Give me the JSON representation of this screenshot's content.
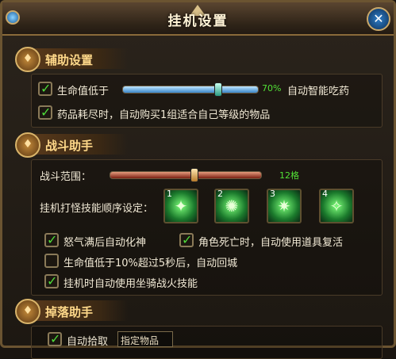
{
  "window": {
    "title": "挂机设置",
    "close_label": "✕"
  },
  "sections": {
    "assist": {
      "title": "辅助设置",
      "hp_label": "生命值低于",
      "hp_percent": "70%",
      "hp_value": 0.7,
      "auto_drink_label": "自动智能吃药",
      "hp_checked": true,
      "auto_buy_label": "药品耗尽时，自动购买1组适合自己等级的物品",
      "auto_buy_checked": true
    },
    "battle": {
      "title": "战斗助手",
      "range_label": "战斗范围：",
      "range_value_text": "12格",
      "range_fraction": 0.55,
      "skill_order_label": "挂机打怪技能顺序设定：",
      "skills": [
        {
          "num": "1",
          "icon": "green-blade-skill-icon"
        },
        {
          "num": "2",
          "icon": "green-burst-skill-icon"
        },
        {
          "num": "3",
          "icon": "green-beast-skill-icon"
        },
        {
          "num": "4",
          "icon": "green-strike-skill-icon"
        }
      ],
      "options": [
        {
          "label": "怒气满后自动化神",
          "checked": true
        },
        {
          "label": "角色死亡时，自动使用道具复活",
          "checked": true
        },
        {
          "label": "生命值低于10%超过5秒后，自动回城",
          "checked": false
        },
        {
          "label": "挂机时自动使用坐骑战火技能",
          "checked": true
        }
      ]
    },
    "loot": {
      "title": "掉落助手",
      "auto_pickup_label": "自动拾取",
      "auto_pickup_checked": true,
      "filter_value": "指定物品"
    }
  },
  "colors": {
    "value_green": "#52e036",
    "check_green": "#4fdc3a",
    "section_gold": "#ffd98a"
  }
}
